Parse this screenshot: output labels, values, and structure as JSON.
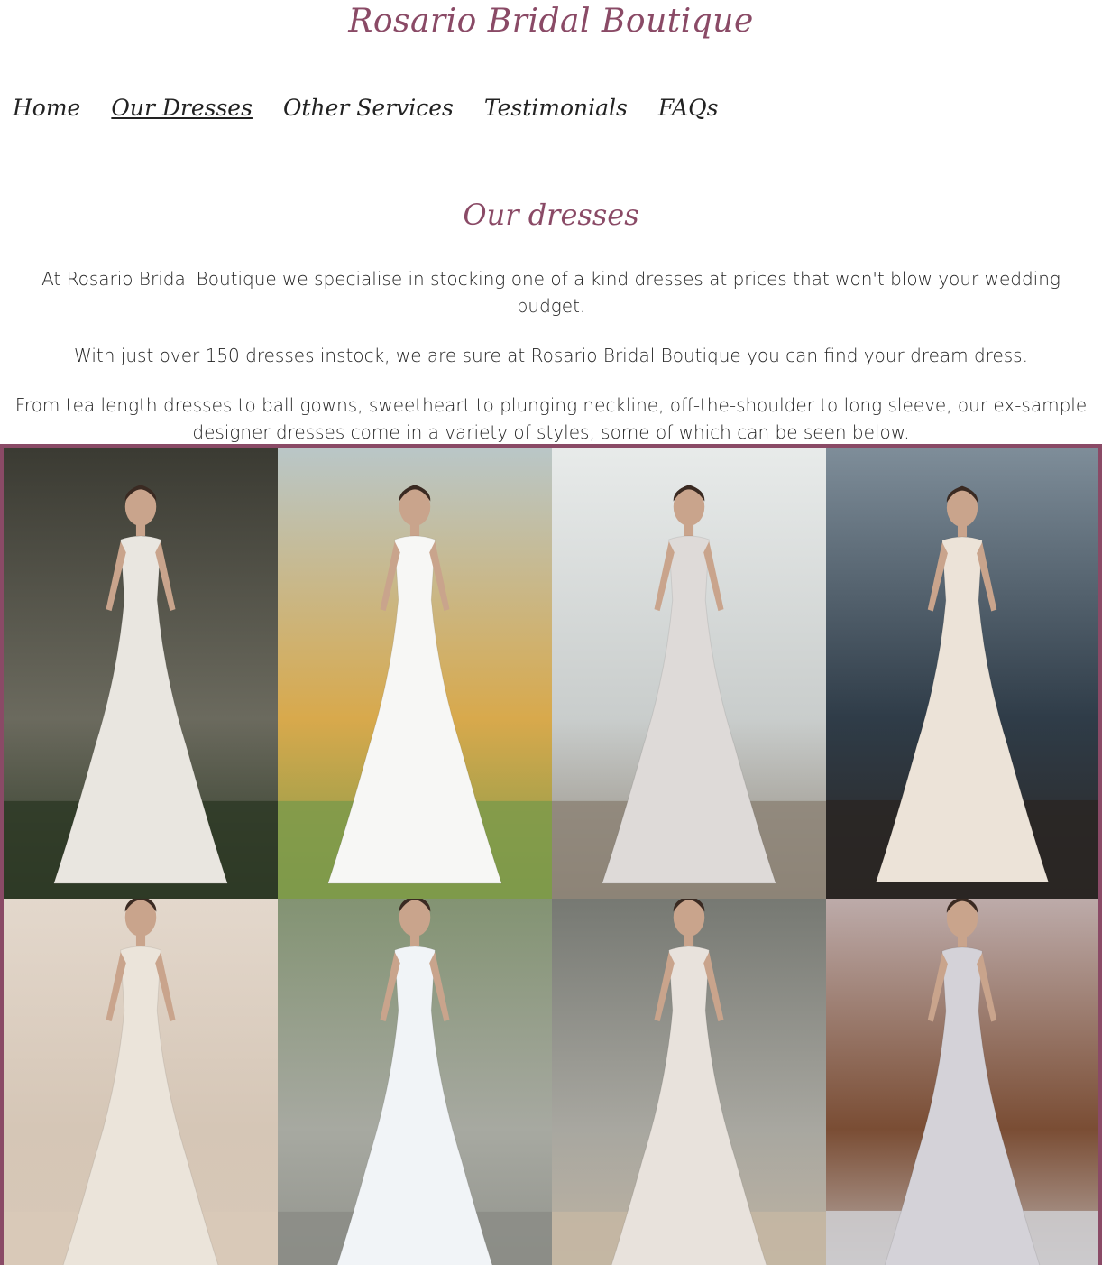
{
  "site": {
    "title": "Rosario Bridal Boutique"
  },
  "nav": {
    "items": [
      {
        "label": "Home",
        "active": false
      },
      {
        "label": "Our Dresses",
        "active": true
      },
      {
        "label": "Other Services",
        "active": false
      },
      {
        "label": "Testimonials",
        "active": false
      },
      {
        "label": "FAQs",
        "active": false
      }
    ]
  },
  "main": {
    "title": "Our dresses",
    "paragraphs": [
      "At Rosario Bridal Boutique we specialise in stocking one of a kind dresses at prices that won't blow your wedding budget.",
      "With just over 150 dresses instock, we are sure at Rosario Bridal Boutique you can find your dream dress.",
      "From tea length dresses to ball gowns, sweetheart to plunging neckline, off-the-shoulder to long sleeve, our ex-sample designer dresses come in a variety of styles, some of which can be seen below."
    ]
  },
  "colors": {
    "accent": "#8a4a66",
    "text": "#222222"
  },
  "gallery": {
    "photos": [
      {
        "scene": "stone-wall",
        "bg1": "#3a3a32",
        "bg2": "#6b6a5e",
        "ground": "#2e3a26",
        "dress": "#e9e6e0"
      },
      {
        "scene": "lakeside",
        "bg1": "#b9c7c9",
        "bg2": "#d8a94c",
        "ground": "#7e9a4a",
        "dress": "#f7f7f5"
      },
      {
        "scene": "window-room",
        "bg1": "#e8ebea",
        "bg2": "#c9cdcc",
        "ground": "#8d8477",
        "dress": "#dedad8"
      },
      {
        "scene": "sea-rocks",
        "bg1": "#7f8e9a",
        "bg2": "#2f3c48",
        "ground": "#2a2623",
        "dress": "#ece3d8"
      },
      {
        "scene": "pampas-studio",
        "bg1": "#e6dbd0",
        "bg2": "#d5c6b6",
        "ground": "#d9c9b8",
        "dress": "#ebe4da"
      },
      {
        "scene": "park-path",
        "bg1": "#7c8f6a",
        "bg2": "#a7a9a1",
        "ground": "#8b8c86",
        "dress": "#f1f4f7"
      },
      {
        "scene": "chair-room",
        "bg1": "#6d706a",
        "bg2": "#a8a7a0",
        "ground": "#c6b7a3",
        "dress": "#e8e2dc"
      },
      {
        "scene": "canopy-bed",
        "bg1": "#c9bcbf",
        "bg2": "#7a4d34",
        "ground": "#cfcfd2",
        "dress": "#d4d2d8"
      }
    ]
  }
}
